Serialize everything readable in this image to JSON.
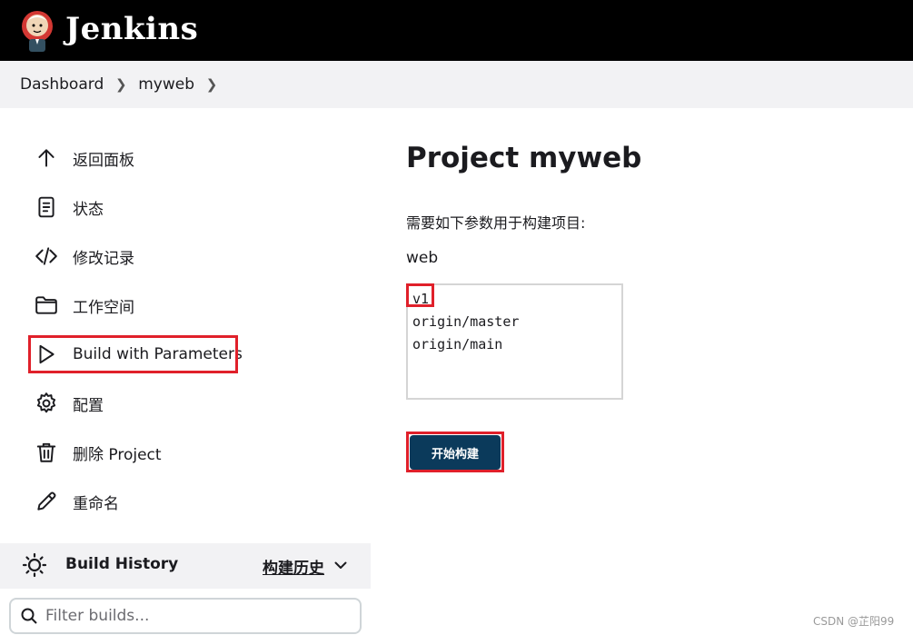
{
  "header": {
    "brand": "Jenkins",
    "logo_icon": "jenkins-butler-icon"
  },
  "breadcrumb": {
    "items": [
      "Dashboard",
      "myweb"
    ]
  },
  "sidebar": {
    "items": [
      {
        "label": "返回面板",
        "icon": "arrow-up-icon"
      },
      {
        "label": "状态",
        "icon": "document-icon"
      },
      {
        "label": "修改记录",
        "icon": "code-icon"
      },
      {
        "label": "工作空间",
        "icon": "folder-icon"
      },
      {
        "label": "Build with Parameters",
        "icon": "play-icon"
      },
      {
        "label": "配置",
        "icon": "gear-icon"
      },
      {
        "label": "删除 Project",
        "icon": "trash-icon"
      },
      {
        "label": "重命名",
        "icon": "pencil-icon"
      }
    ]
  },
  "build_history": {
    "title": "Build History",
    "trend_link": "构建历史",
    "filter_placeholder": "Filter builds..."
  },
  "main": {
    "title": "Project myweb",
    "description": "需要如下参数用于构建项目:",
    "parameter_name": "web",
    "options": [
      "v1",
      "origin/master",
      "origin/main"
    ],
    "build_button": "开始构建"
  },
  "watermark": "CSDN @芷阳99",
  "colors": {
    "highlight": "#e0202a",
    "button": "#0b3a5b",
    "header": "#000000"
  }
}
